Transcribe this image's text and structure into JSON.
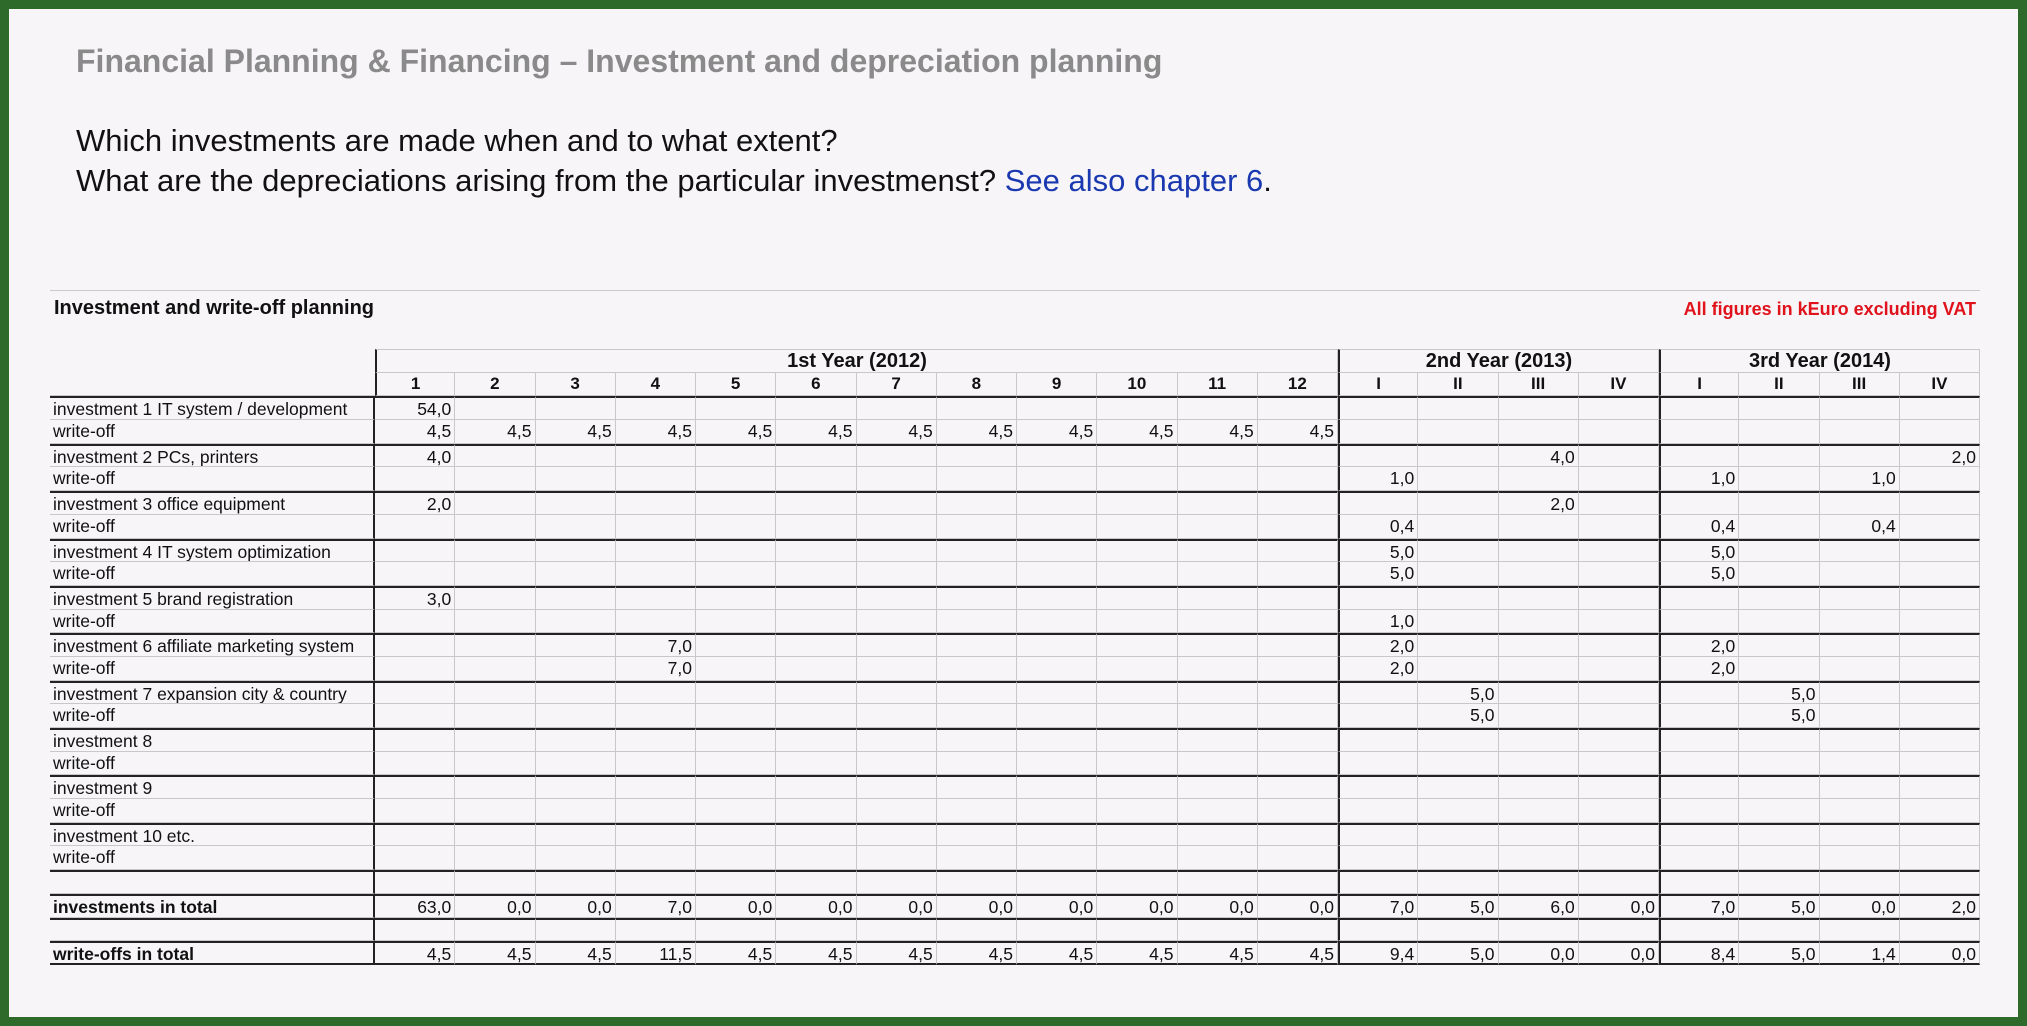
{
  "header": {
    "title": "Financial Planning & Financing – Investment and depreciation planning",
    "question1": "Which investments are made when and to what extent?",
    "question2": "What are the depreciations arising from the particular investmenst?",
    "link": "See also chapter 6",
    "link_suffix": "."
  },
  "table": {
    "title": "Investment and write-off planning",
    "note": "All figures in kEuro excluding VAT",
    "years": [
      {
        "label": "1st Year (2012)",
        "span": 12
      },
      {
        "label": "2nd Year (2013)",
        "span": 4
      },
      {
        "label": "3rd Year (2014)",
        "span": 4
      }
    ],
    "columns": [
      "1",
      "2",
      "3",
      "4",
      "5",
      "6",
      "7",
      "8",
      "9",
      "10",
      "11",
      "12",
      "I",
      "II",
      "III",
      "IV",
      "I",
      "II",
      "III",
      "IV"
    ],
    "rows": [
      {
        "label": "investment 1  IT system / development",
        "values": [
          "54,0",
          "",
          "",
          "",
          "",
          "",
          "",
          "",
          "",
          "",
          "",
          "",
          "",
          "",
          "",
          "",
          "",
          "",
          "",
          ""
        ],
        "group_start": true
      },
      {
        "label": "write-off",
        "values": [
          "4,5",
          "4,5",
          "4,5",
          "4,5",
          "4,5",
          "4,5",
          "4,5",
          "4,5",
          "4,5",
          "4,5",
          "4,5",
          "4,5",
          "",
          "",
          "",
          "",
          "",
          "",
          "",
          ""
        ]
      },
      {
        "label": "investment 2 PCs, printers",
        "values": [
          "4,0",
          "",
          "",
          "",
          "",
          "",
          "",
          "",
          "",
          "",
          "",
          "",
          "",
          "",
          "4,0",
          "",
          "",
          "",
          "",
          "2,0"
        ],
        "group_start": true
      },
      {
        "label": "write-off",
        "values": [
          "",
          "",
          "",
          "",
          "",
          "",
          "",
          "",
          "",
          "",
          "",
          "",
          "1,0",
          "",
          "",
          "",
          "1,0",
          "",
          "1,0",
          ""
        ]
      },
      {
        "label": "investment 3 office equipment",
        "values": [
          "2,0",
          "",
          "",
          "",
          "",
          "",
          "",
          "",
          "",
          "",
          "",
          "",
          "",
          "",
          "2,0",
          "",
          "",
          "",
          "",
          ""
        ],
        "group_start": true
      },
      {
        "label": "write-off",
        "values": [
          "",
          "",
          "",
          "",
          "",
          "",
          "",
          "",
          "",
          "",
          "",
          "",
          "0,4",
          "",
          "",
          "",
          "0,4",
          "",
          "0,4",
          ""
        ]
      },
      {
        "label": "investment 4 IT system optimization",
        "values": [
          "",
          "",
          "",
          "",
          "",
          "",
          "",
          "",
          "",
          "",
          "",
          "",
          "5,0",
          "",
          "",
          "",
          "5,0",
          "",
          "",
          ""
        ],
        "group_start": true
      },
      {
        "label": "write-off",
        "values": [
          "",
          "",
          "",
          "",
          "",
          "",
          "",
          "",
          "",
          "",
          "",
          "",
          "5,0",
          "",
          "",
          "",
          "5,0",
          "",
          "",
          ""
        ]
      },
      {
        "label": "investment 5 brand registration",
        "values": [
          "3,0",
          "",
          "",
          "",
          "",
          "",
          "",
          "",
          "",
          "",
          "",
          "",
          "",
          "",
          "",
          "",
          "",
          "",
          "",
          ""
        ],
        "group_start": true
      },
      {
        "label": "write-off",
        "values": [
          "",
          "",
          "",
          "",
          "",
          "",
          "",
          "",
          "",
          "",
          "",
          "",
          "1,0",
          "",
          "",
          "",
          "",
          "",
          "",
          ""
        ]
      },
      {
        "label": "investment 6 affiliate marketing system",
        "values": [
          "",
          "",
          "",
          "7,0",
          "",
          "",
          "",
          "",
          "",
          "",
          "",
          "",
          "2,0",
          "",
          "",
          "",
          "2,0",
          "",
          "",
          ""
        ],
        "group_start": true
      },
      {
        "label": "write-off",
        "values": [
          "",
          "",
          "",
          "7,0",
          "",
          "",
          "",
          "",
          "",
          "",
          "",
          "",
          "2,0",
          "",
          "",
          "",
          "2,0",
          "",
          "",
          ""
        ]
      },
      {
        "label": "investment 7 expansion city & country",
        "values": [
          "",
          "",
          "",
          "",
          "",
          "",
          "",
          "",
          "",
          "",
          "",
          "",
          "",
          "5,0",
          "",
          "",
          "",
          "5,0",
          "",
          ""
        ],
        "group_start": true
      },
      {
        "label": "write-off",
        "values": [
          "",
          "",
          "",
          "",
          "",
          "",
          "",
          "",
          "",
          "",
          "",
          "",
          "",
          "5,0",
          "",
          "",
          "",
          "5,0",
          "",
          ""
        ]
      },
      {
        "label": "investment 8",
        "values": [
          "",
          "",
          "",
          "",
          "",
          "",
          "",
          "",
          "",
          "",
          "",
          "",
          "",
          "",
          "",
          "",
          "",
          "",
          "",
          ""
        ],
        "group_start": true
      },
      {
        "label": "write-off",
        "values": [
          "",
          "",
          "",
          "",
          "",
          "",
          "",
          "",
          "",
          "",
          "",
          "",
          "",
          "",
          "",
          "",
          "",
          "",
          "",
          ""
        ]
      },
      {
        "label": "investment 9",
        "values": [
          "",
          "",
          "",
          "",
          "",
          "",
          "",
          "",
          "",
          "",
          "",
          "",
          "",
          "",
          "",
          "",
          "",
          "",
          "",
          ""
        ],
        "group_start": true
      },
      {
        "label": "write-off",
        "values": [
          "",
          "",
          "",
          "",
          "",
          "",
          "",
          "",
          "",
          "",
          "",
          "",
          "",
          "",
          "",
          "",
          "",
          "",
          "",
          ""
        ]
      },
      {
        "label": "investment 10 etc.",
        "values": [
          "",
          "",
          "",
          "",
          "",
          "",
          "",
          "",
          "",
          "",
          "",
          "",
          "",
          "",
          "",
          "",
          "",
          "",
          "",
          ""
        ],
        "group_start": true
      },
      {
        "label": "write-off",
        "values": [
          "",
          "",
          "",
          "",
          "",
          "",
          "",
          "",
          "",
          "",
          "",
          "",
          "",
          "",
          "",
          "",
          "",
          "",
          "",
          ""
        ]
      }
    ],
    "totals": [
      {
        "label": "investments in total",
        "values": [
          "63,0",
          "0,0",
          "0,0",
          "7,0",
          "0,0",
          "0,0",
          "0,0",
          "0,0",
          "0,0",
          "0,0",
          "0,0",
          "0,0",
          "7,0",
          "5,0",
          "6,0",
          "0,0",
          "7,0",
          "5,0",
          "0,0",
          "2,0"
        ]
      },
      {
        "label": "write-offs in total",
        "values": [
          "4,5",
          "4,5",
          "4,5",
          "11,5",
          "4,5",
          "4,5",
          "4,5",
          "4,5",
          "4,5",
          "4,5",
          "4,5",
          "4,5",
          "9,4",
          "5,0",
          "0,0",
          "0,0",
          "8,4",
          "5,0",
          "1,4",
          "0,0"
        ]
      }
    ]
  },
  "colors": {
    "frame": "#2e6b2a",
    "title": "#8a8a8a",
    "link": "#1a39b0",
    "note": "#e0121b"
  }
}
